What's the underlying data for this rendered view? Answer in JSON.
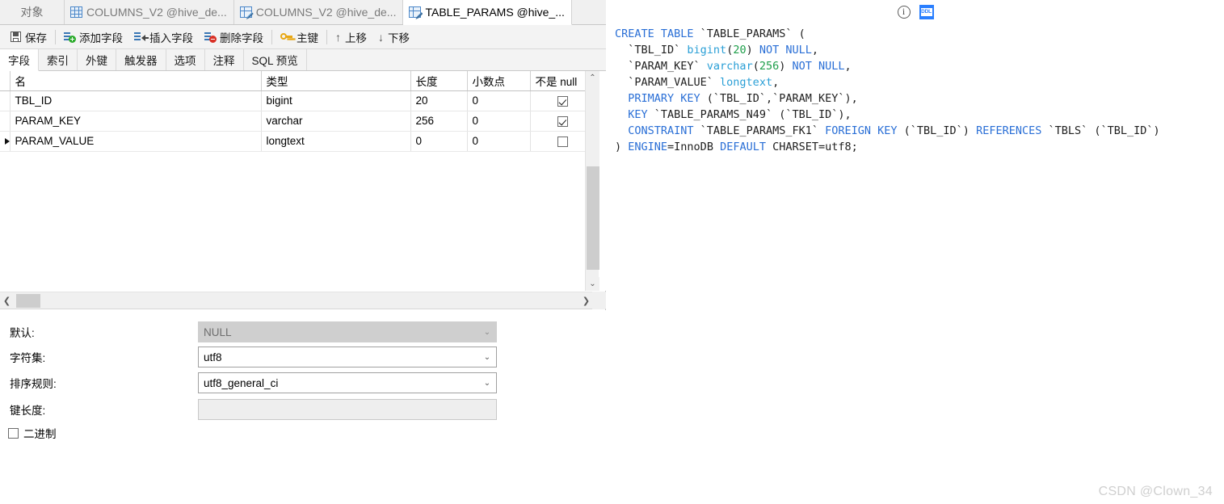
{
  "tabbar": {
    "object_tab": "对象",
    "tabs": [
      {
        "label": "COLUMNS_V2 @hive_de...",
        "icon": "table-grid-icon",
        "active": false
      },
      {
        "label": "COLUMNS_V2 @hive_de...",
        "icon": "table-design-icon",
        "active": false
      },
      {
        "label": "TABLE_PARAMS @hive_...",
        "icon": "table-design-icon",
        "active": true
      }
    ]
  },
  "toolbar": {
    "save": "保存",
    "add_field": "添加字段",
    "insert_field": "插入字段",
    "delete_field": "删除字段",
    "primary_key": "主键",
    "move_up": "上移",
    "move_down": "下移",
    "move_up_glyph": "↑",
    "move_down_glyph": "↓"
  },
  "subtabs": [
    {
      "label": "字段",
      "active": true
    },
    {
      "label": "索引",
      "active": false
    },
    {
      "label": "外键",
      "active": false
    },
    {
      "label": "触发器",
      "active": false
    },
    {
      "label": "选项",
      "active": false
    },
    {
      "label": "注释",
      "active": false
    },
    {
      "label": "SQL 预览",
      "active": false
    }
  ],
  "grid": {
    "columns": [
      "名",
      "类型",
      "长度",
      "小数点",
      "不是 null"
    ],
    "rows": [
      {
        "selected": false,
        "name": "TBL_ID",
        "type": "bigint",
        "length": "20",
        "decimals": "0",
        "not_null": true
      },
      {
        "selected": false,
        "name": "PARAM_KEY",
        "type": "varchar",
        "length": "256",
        "decimals": "0",
        "not_null": true
      },
      {
        "selected": true,
        "name": "PARAM_VALUE",
        "type": "longtext",
        "length": "0",
        "decimals": "0",
        "not_null": false
      }
    ],
    "scroll_up_glyph": "⌃",
    "scroll_down_glyph": "⌄",
    "scroll_left_glyph": "❮",
    "scroll_right_glyph": "❯"
  },
  "properties": {
    "default_label": "默认:",
    "default_value": "NULL",
    "charset_label": "字符集:",
    "charset_value": "utf8",
    "collation_label": "排序规则:",
    "collation_value": "utf8_general_ci",
    "key_length_label": "键长度:",
    "key_length_value": "",
    "binary_label": "二进制",
    "binary_checked": false,
    "caret_glyph": "⌄"
  },
  "sql_pane": {
    "info_icon": "info-icon",
    "info_glyph": "i",
    "ddl_icon": "ddl-icon",
    "lines": [
      [
        {
          "t": "CREATE TABLE ",
          "c": "kw"
        },
        {
          "t": "`TABLE_PARAMS` (",
          "c": "id"
        }
      ],
      [
        {
          "t": "  `TBL_ID` ",
          "c": "id"
        },
        {
          "t": "bigint",
          "c": "ty"
        },
        {
          "t": "(",
          "c": "id"
        },
        {
          "t": "20",
          "c": "num"
        },
        {
          "t": ") ",
          "c": "id"
        },
        {
          "t": "NOT NULL",
          "c": "kw"
        },
        {
          "t": ",",
          "c": "id"
        }
      ],
      [
        {
          "t": "  `PARAM_KEY` ",
          "c": "id"
        },
        {
          "t": "varchar",
          "c": "ty"
        },
        {
          "t": "(",
          "c": "id"
        },
        {
          "t": "256",
          "c": "num"
        },
        {
          "t": ") ",
          "c": "id"
        },
        {
          "t": "NOT NULL",
          "c": "kw"
        },
        {
          "t": ",",
          "c": "id"
        }
      ],
      [
        {
          "t": "  `PARAM_VALUE` ",
          "c": "id"
        },
        {
          "t": "longtext",
          "c": "ty"
        },
        {
          "t": ",",
          "c": "id"
        }
      ],
      [
        {
          "t": "  ",
          "c": "id"
        },
        {
          "t": "PRIMARY KEY",
          "c": "kw"
        },
        {
          "t": " (`TBL_ID`,`PARAM_KEY`),",
          "c": "id"
        }
      ],
      [
        {
          "t": "  ",
          "c": "id"
        },
        {
          "t": "KEY",
          "c": "kw"
        },
        {
          "t": " `TABLE_PARAMS_N49` (`TBL_ID`),",
          "c": "id"
        }
      ],
      [
        {
          "t": "  ",
          "c": "id"
        },
        {
          "t": "CONSTRAINT",
          "c": "kw"
        },
        {
          "t": " `TABLE_PARAMS_FK1` ",
          "c": "id"
        },
        {
          "t": "FOREIGN KEY",
          "c": "kw"
        },
        {
          "t": " (`TBL_ID`) ",
          "c": "id"
        },
        {
          "t": "REFERENCES",
          "c": "kw"
        },
        {
          "t": " `TBLS` (`TBL_ID`)",
          "c": "id"
        }
      ],
      [
        {
          "t": ") ",
          "c": "id"
        },
        {
          "t": "ENGINE",
          "c": "kw"
        },
        {
          "t": "=InnoDB ",
          "c": "id"
        },
        {
          "t": "DEFAULT",
          "c": "kw"
        },
        {
          "t": " CHARSET=utf8;",
          "c": "id"
        }
      ]
    ]
  },
  "watermark": "CSDN @Clown_34"
}
